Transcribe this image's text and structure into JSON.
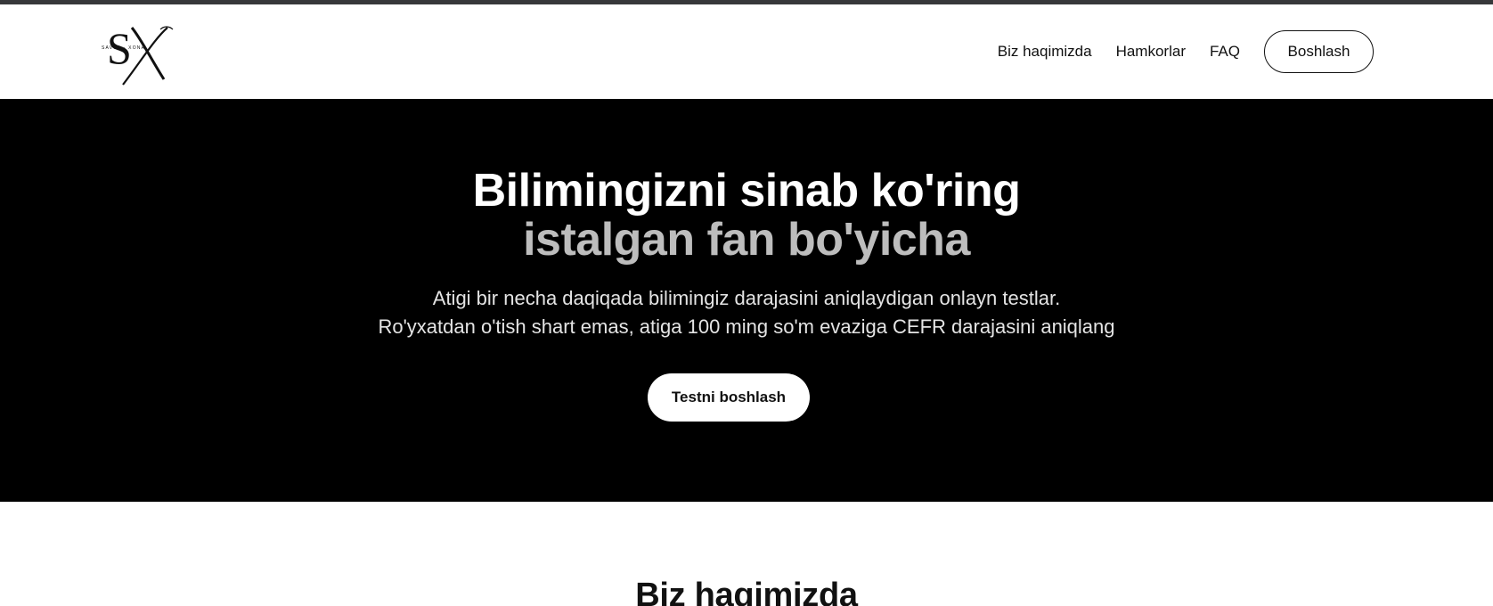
{
  "header": {
    "logo_text": "SX",
    "logo_tagline": "SAVOL · XONA",
    "nav": [
      {
        "label": "Biz haqimizda"
      },
      {
        "label": "Hamkorlar"
      },
      {
        "label": "FAQ"
      }
    ],
    "start_label": "Boshlash"
  },
  "hero": {
    "title_line1": "Bilimingizni sinab ko'ring",
    "title_line2": "istalgan fan bo'yicha",
    "subtitle_line1": "Atigi bir necha daqiqada bilimingiz darajasini aniqlaydigan onlayn testlar.",
    "subtitle_line2": "Ro'yxatdan o'tish shart emas, atiga 100 ming so'm evaziga CEFR darajasini aniqlang",
    "cta_label": "Testni boshlash"
  },
  "about": {
    "title": "Biz haqimizda"
  },
  "colors": {
    "hero_bg": "#000000",
    "title_accent_gray": "#bdbdbd",
    "top_strip": "#37383a"
  }
}
